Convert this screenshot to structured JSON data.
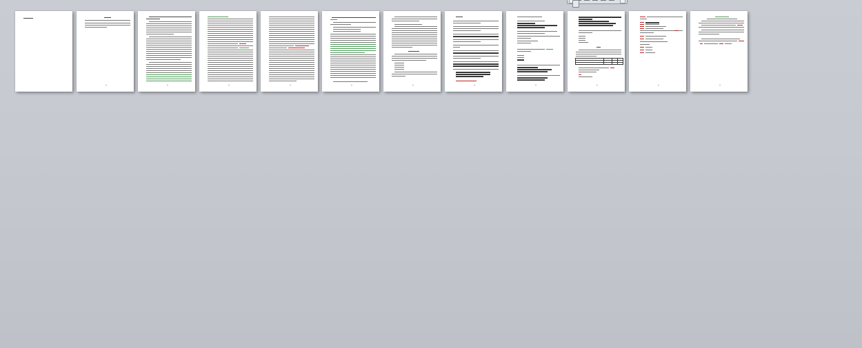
{
  "view": {
    "page_count": 12,
    "background_color": "#c6cad0"
  },
  "zoom_control": {
    "icon": "zoom-slider-icon"
  },
  "pages": [
    {
      "index": 1,
      "kind": "title"
    },
    {
      "index": 2,
      "kind": "contents"
    },
    {
      "index": 3,
      "kind": "text",
      "highlight": "green-bottom"
    },
    {
      "index": 4,
      "kind": "text",
      "highlight": "green-top"
    },
    {
      "index": 5,
      "kind": "text",
      "highlight": "red-middle"
    },
    {
      "index": 6,
      "kind": "text",
      "highlight": "green-middle"
    },
    {
      "index": 7,
      "kind": "list"
    },
    {
      "index": 8,
      "kind": "list",
      "highlight": "underline"
    },
    {
      "index": 9,
      "kind": "list",
      "highlight": "underline"
    },
    {
      "index": 10,
      "kind": "table"
    },
    {
      "index": 11,
      "kind": "list",
      "highlight": "red"
    },
    {
      "index": 12,
      "kind": "text",
      "highlight": "red"
    }
  ]
}
